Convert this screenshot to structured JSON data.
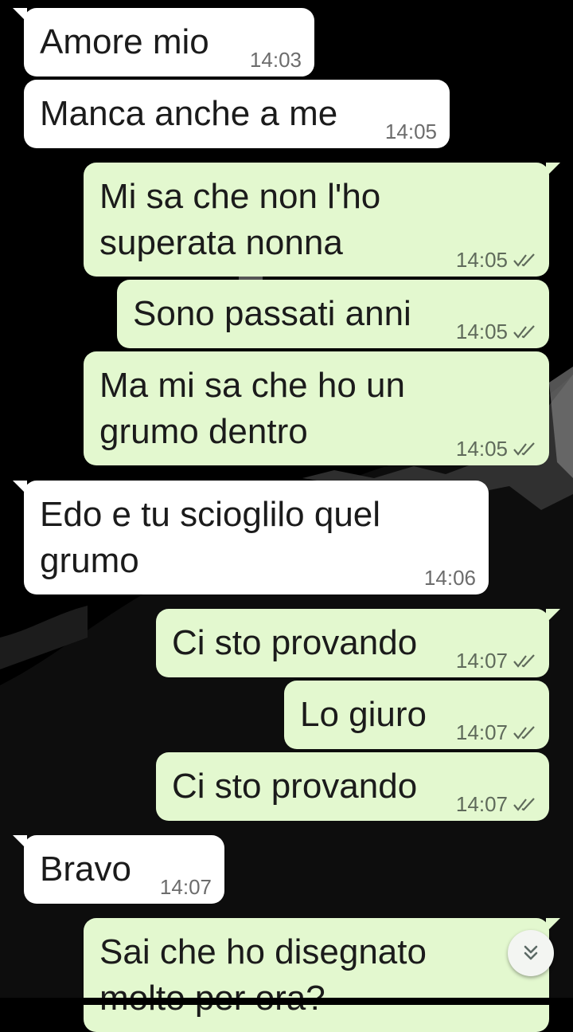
{
  "colors": {
    "incoming_bubble": "#ffffff",
    "outgoing_bubble": "#e3f8cf",
    "background": "#000000",
    "tick": "#5f6a5b"
  },
  "messages": [
    {
      "direction": "incoming",
      "text": "Amore mio",
      "time": "14:03"
    },
    {
      "direction": "incoming",
      "text": "Manca anche a me",
      "time": "14:05"
    },
    {
      "direction": "outgoing",
      "text": "Mi sa che non l'ho\nsuperata nonna",
      "time": "14:05",
      "status": "read-ticks-icon"
    },
    {
      "direction": "outgoing",
      "text": "Sono passati anni",
      "time": "14:05",
      "status": "read-ticks-icon"
    },
    {
      "direction": "outgoing",
      "text": "Ma mi sa che ho un\ngrumo dentro",
      "time": "14:05",
      "status": "read-ticks-icon"
    },
    {
      "direction": "incoming",
      "text": "Edo e tu scioglilo quel\ngrumo",
      "time": "14:06"
    },
    {
      "direction": "outgoing",
      "text": "Ci sto provando",
      "time": "14:07",
      "status": "read-ticks-icon"
    },
    {
      "direction": "outgoing",
      "text": "Lo giuro",
      "time": "14:07",
      "status": "read-ticks-icon"
    },
    {
      "direction": "outgoing",
      "text": "Ci sto provando",
      "time": "14:07",
      "status": "read-ticks-icon"
    },
    {
      "direction": "incoming",
      "text": "Bravo",
      "time": "14:07"
    },
    {
      "direction": "outgoing",
      "text": "Sai che ho disegnato\nmolto per ora?",
      "time": ""
    }
  ],
  "scroll_button": {
    "icon": "double-chevron-down-icon"
  }
}
